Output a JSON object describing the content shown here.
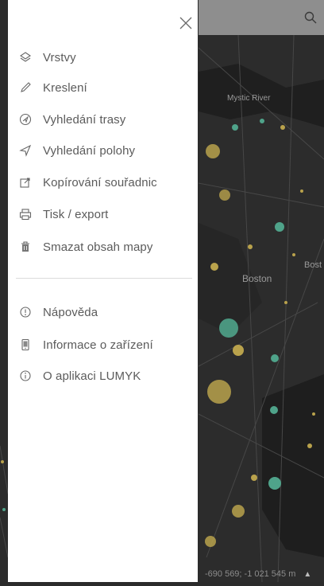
{
  "map": {
    "labels": {
      "river": "Mystic River",
      "city": "Boston",
      "edge_city": "Bost"
    },
    "coordinates": "-690 569; -1 021 545 m"
  },
  "drawer": {
    "primary_items": [
      {
        "label": "Vrstvy",
        "icon": "layers-icon"
      },
      {
        "label": "Kreslení",
        "icon": "pencil-icon"
      },
      {
        "label": "Vyhledání trasy",
        "icon": "route-icon"
      },
      {
        "label": "Vyhledání polohy",
        "icon": "location-arrow-icon"
      },
      {
        "label": "Kopírování souřadnic",
        "icon": "copy-icon"
      },
      {
        "label": "Tisk / export",
        "icon": "print-icon"
      },
      {
        "label": "Smazat obsah mapy",
        "icon": "trash-icon"
      }
    ],
    "secondary_items": [
      {
        "label": "Nápověda",
        "icon": "help-icon"
      },
      {
        "label": "Informace o zařízení",
        "icon": "device-icon"
      },
      {
        "label": "O aplikaci LUMYK",
        "icon": "info-icon"
      }
    ]
  },
  "colors": {
    "map_background": "#2b2b2b",
    "topbar": "#8e8e8e",
    "dot_yellow": "#b9a24c",
    "dot_teal": "#4fa38a",
    "drawer_text": "#5b5b5b"
  }
}
